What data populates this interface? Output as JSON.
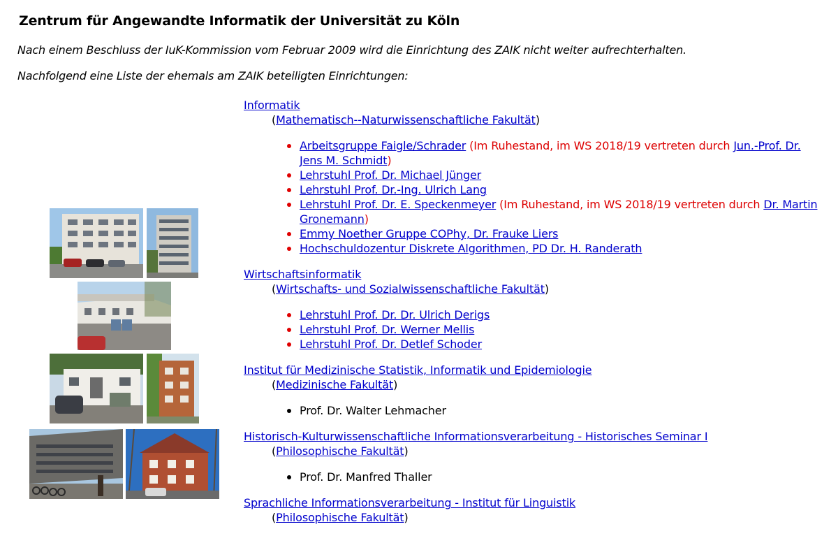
{
  "page": {
    "title": "Zentrum für Angewandte Informatik der Universität zu Köln",
    "intro_1": "Nach einem Beschluss der IuK-Kommission vom Februar 2009 wird die Einrichtung des ZAIK nicht weiter aufrechterhalten.",
    "intro_2": "Nachfolgend eine Liste der ehemals am ZAIK beteiligten Einrichtungen:"
  },
  "sections": [
    {
      "name": "Informatik",
      "faculty": "Mathematisch--Naturwissenschaftliche Fakultät",
      "chairs": [
        {
          "label": "Arbeitsgruppe Faigle/Schrader",
          "note_pre": " (Im Ruhestand, im WS 2018/19 vertreten durch ",
          "note_link": "Jun.-Prof. Dr. Jens M. Schmidt",
          "note_post": ")"
        },
        {
          "label": "Lehrstuhl Prof. Dr. Michael Jünger"
        },
        {
          "label": "Lehrstuhl Prof. Dr.-Ing. Ulrich Lang"
        },
        {
          "label": "Lehrstuhl Prof. Dr. E. Speckenmeyer",
          "note_pre": " (Im Ruhestand, im WS 2018/19 vertreten durch ",
          "note_link": "Dr. Martin Gronemann",
          "note_post": ")"
        },
        {
          "label": "Emmy Noether Gruppe COPhy, Dr. Frauke Liers"
        },
        {
          "label": "Hochschuldozentur Diskrete Algorithmen, PD Dr. H. Randerath"
        }
      ]
    },
    {
      "name": "Wirtschaftsinformatik",
      "faculty": "Wirtschafts- und Sozialwissenschaftliche Fakultät",
      "chairs": [
        {
          "label": "Lehrstuhl Prof. Dr. Dr. Ulrich Derigs"
        },
        {
          "label": "Lehrstuhl Prof. Dr. Werner Mellis"
        },
        {
          "label": "Lehrstuhl Prof. Dr. Detlef Schoder"
        }
      ]
    },
    {
      "name": "Institut für Medizinische Statistik, Informatik und Epidemiologie",
      "faculty": "Medizinische Fakultät",
      "person": "Prof. Dr. Walter Lehmacher"
    },
    {
      "name": "Historisch-Kulturwissenschaftliche Informationsverarbeitung - Historisches Seminar I",
      "faculty": "Philosophische Fakultät",
      "person": "Prof. Dr. Manfred Thaller"
    },
    {
      "name": "Sprachliche Informationsverarbeitung - Institut für Linguistik",
      "faculty": "Philosophische Fakultät"
    }
  ],
  "colors": {
    "link": "#0000cc",
    "note": "#dd0000",
    "bullet": "#e00000"
  }
}
